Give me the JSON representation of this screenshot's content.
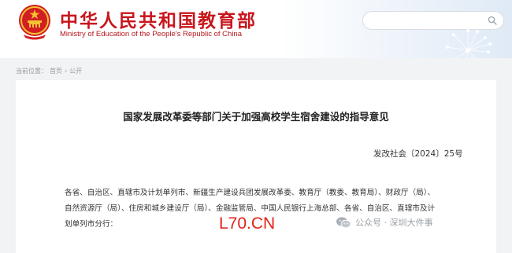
{
  "header": {
    "site_title": "中华人民共和国教育部",
    "site_subtitle": "Ministry of Education of the People's Republic of China",
    "search": {
      "placeholder": "",
      "value": ""
    },
    "brand_color": "#c8161d",
    "icons": {
      "emblem": "national-emblem-icon",
      "search": "search-icon"
    }
  },
  "breadcrumb": {
    "prefix": "当前位置：",
    "items": [
      "首页",
      "公开"
    ],
    "separator": "›"
  },
  "document": {
    "title": "国家发展改革委等部门关于加强高校学生宿舍建设的指导意见",
    "number": "发改社会〔2024〕25号",
    "body_lines": [
      "各省、自治区、直辖市及计划单列市、新疆生产建设兵团发展改革委、教育厅（教委、教育局）、财政厅（局）、",
      "自然资源厅（局）、住房和城乡建设厅（局）、金融监管局、中国人民银行上海总部、各省、自治区、直辖市及计",
      "划单列市分行："
    ]
  },
  "watermarks": {
    "wechat_text": "公众号 · 深圳大件事",
    "brand": "L70.CN",
    "brand_color": "#e2231a"
  }
}
